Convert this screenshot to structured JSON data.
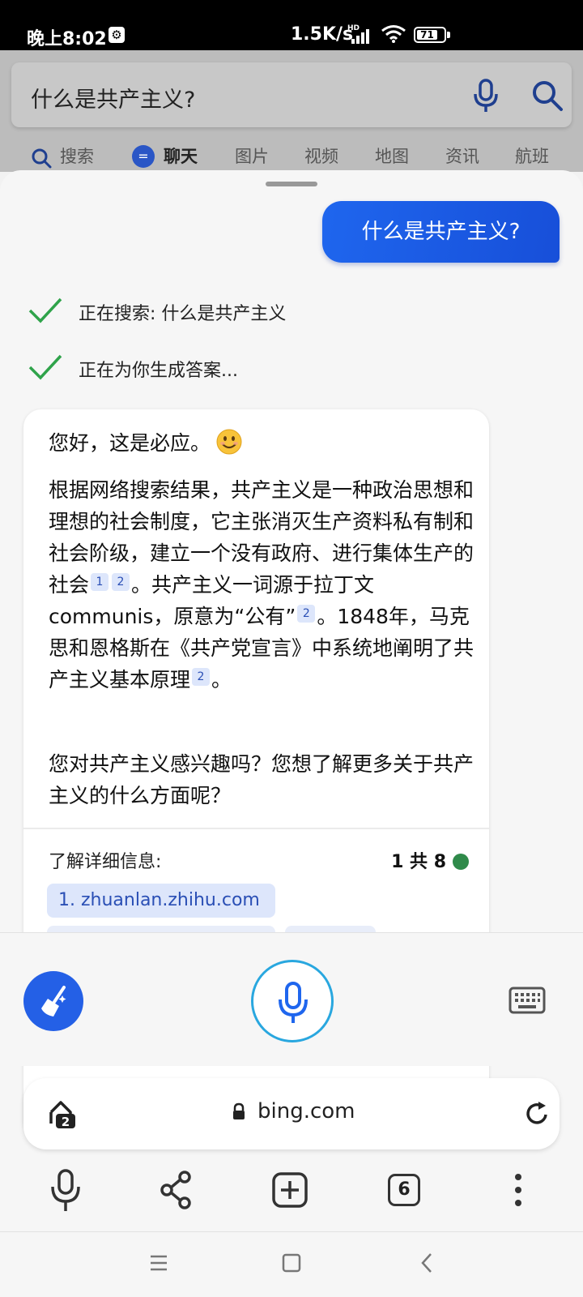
{
  "status_bar": {
    "time": "晚上8:02",
    "net_speed": "1.5K/s",
    "hd_badge": "HD",
    "battery": "71"
  },
  "search": {
    "query": "什么是共产主义?",
    "tabs": [
      "搜索",
      "聊天",
      "图片",
      "视频",
      "地图",
      "资讯",
      "航班"
    ],
    "active_tab": "聊天"
  },
  "chat": {
    "user_message": "什么是共产主义?",
    "status_lines": [
      "正在搜索: 什么是共产主义",
      "正在为你生成答案..."
    ],
    "greeting": "您好，这是必应。",
    "answer_segments": [
      "根据网络搜索结果，共产主义是一种政治思想和理想的社会制度，它主张消灭生产资料私有制和社会阶级，建立一个没有政府、进行集体生产的社会",
      "。共产主义一词源于拉丁文communis，原意为“公有”",
      "。1848年，马克思和恩格斯在《共产党宣言》中系统地阐明了共产主义基本原理",
      "。"
    ],
    "citations": [
      "1",
      "2",
      "2",
      "2"
    ],
    "followup": "您对共产主义感兴趣吗？您想了解更多关于共产主义的什么方面呢？",
    "learn_more_label": "了解详细信息:",
    "pager": "1 共 8",
    "source_chip": "1. zhuanlan.zhihu.com"
  },
  "browser": {
    "tab_count_badge": "2",
    "url": "bing.com",
    "open_tabs": "6"
  },
  "icons": {
    "accent": "#1f66ee",
    "check": "#2fa34a",
    "mic_ring": "#29a7df"
  }
}
